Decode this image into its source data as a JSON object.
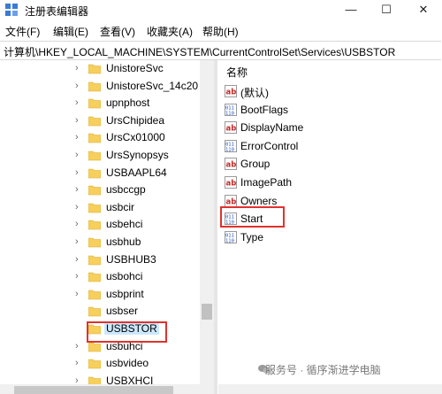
{
  "window": {
    "title": "注册表编辑器",
    "minimize_glyph": "—",
    "maximize_glyph": "☐",
    "close_glyph": "✕"
  },
  "menu": [
    "文件(F)",
    "编辑(E)",
    "查看(V)",
    "收藏夹(A)",
    "帮助(H)"
  ],
  "address": "计算机\\HKEY_LOCAL_MACHINE\\SYSTEM\\CurrentControlSet\\Services\\USBSTOR",
  "tree": {
    "items": [
      {
        "label": "UnistoreSvc",
        "expandable": true
      },
      {
        "label": "UnistoreSvc_14c20",
        "expandable": true
      },
      {
        "label": "upnphost",
        "expandable": true
      },
      {
        "label": "UrsChipidea",
        "expandable": true
      },
      {
        "label": "UrsCx01000",
        "expandable": true
      },
      {
        "label": "UrsSynopsys",
        "expandable": true
      },
      {
        "label": "USBAAPL64",
        "expandable": true
      },
      {
        "label": "usbccgp",
        "expandable": true
      },
      {
        "label": "usbcir",
        "expandable": true
      },
      {
        "label": "usbehci",
        "expandable": true
      },
      {
        "label": "usbhub",
        "expandable": true
      },
      {
        "label": "USBHUB3",
        "expandable": true
      },
      {
        "label": "usbohci",
        "expandable": true
      },
      {
        "label": "usbprint",
        "expandable": true
      },
      {
        "label": "usbser",
        "expandable": false
      },
      {
        "label": "USBSTOR",
        "expandable": false,
        "selected": true
      },
      {
        "label": "usbuhci",
        "expandable": true
      },
      {
        "label": "usbvideo",
        "expandable": true
      },
      {
        "label": "USBXHCI",
        "expandable": true
      }
    ]
  },
  "values": {
    "column_header": "名称",
    "items": [
      {
        "label": "(默认)",
        "icon": "string-value-icon"
      },
      {
        "label": "BootFlags",
        "icon": "dword-value-icon"
      },
      {
        "label": "DisplayName",
        "icon": "string-value-icon"
      },
      {
        "label": "ErrorControl",
        "icon": "dword-value-icon"
      },
      {
        "label": "Group",
        "icon": "string-value-icon"
      },
      {
        "label": "ImagePath",
        "icon": "string-value-icon"
      },
      {
        "label": "Owners",
        "icon": "string-value-icon"
      },
      {
        "label": "Start",
        "icon": "dword-value-icon"
      },
      {
        "label": "Type",
        "icon": "dword-value-icon"
      }
    ]
  },
  "watermark": "服务号 · 循序渐进学电脑",
  "colors": {
    "annotation_red": "#e0322e",
    "folder_yellow": "#f7cf5c",
    "selection_blue": "#cce8ff"
  }
}
